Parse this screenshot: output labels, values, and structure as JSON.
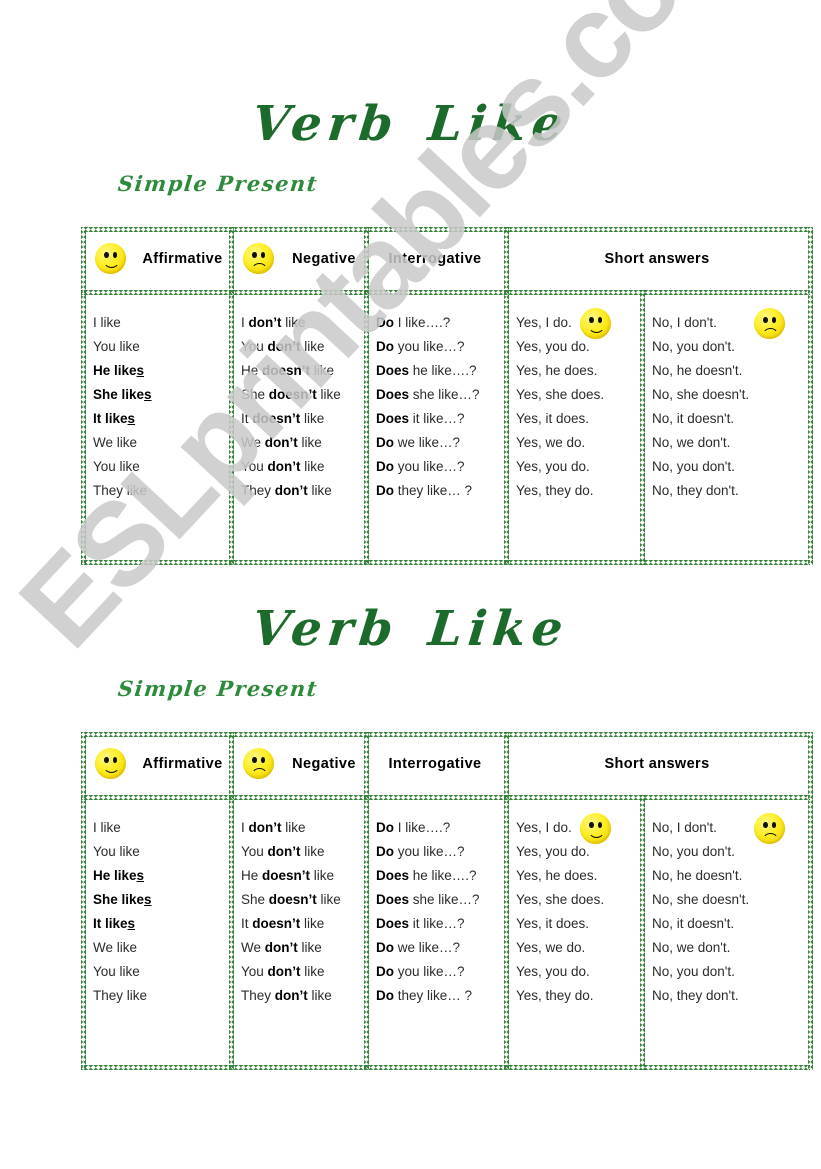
{
  "page": {
    "title": "Verb Like",
    "title_word_1": "Verb",
    "title_word_2": "Like",
    "subtitle": "Simple Present",
    "watermark": "ESLprintables.com",
    "accent_green": "#2d7a33",
    "title_green": "#1d6b2c",
    "subtitle_green": "#2e8b3d",
    "face_yellow": "#ffee26"
  },
  "table": {
    "headers": [
      {
        "label": "Affirmative",
        "icon": "happy-face-icon"
      },
      {
        "label": "Negative",
        "icon": "sad-face-icon"
      },
      {
        "label": "Interrogative",
        "icon": ""
      },
      {
        "label": "Short answers",
        "icon": ""
      }
    ],
    "columns": {
      "affirmative": [
        {
          "subject": "I",
          "verb": "like",
          "bold": false,
          "underline_last": false
        },
        {
          "subject": "You",
          "verb": "like",
          "bold": false,
          "underline_last": false
        },
        {
          "subject": "He",
          "verb": "likes",
          "bold": true,
          "underline_last": true
        },
        {
          "subject": "She",
          "verb": "likes",
          "bold": true,
          "underline_last": true
        },
        {
          "subject": "It",
          "verb": "likes",
          "bold": true,
          "underline_last": true
        },
        {
          "subject": "We",
          "verb": "like",
          "bold": false,
          "underline_last": false
        },
        {
          "subject": "You",
          "verb": "like",
          "bold": false,
          "underline_last": false
        },
        {
          "subject": "They",
          "verb": "like",
          "bold": false,
          "underline_last": false
        }
      ],
      "negative": [
        {
          "subject": "I",
          "aux": "don’t",
          "verb": "like"
        },
        {
          "subject": "You",
          "aux": "don’t",
          "verb": "like"
        },
        {
          "subject": "He",
          "aux": "doesn’t",
          "verb": "like"
        },
        {
          "subject": "She",
          "aux": "doesn’t",
          "verb": "like"
        },
        {
          "subject": "It",
          "aux": "doesn’t",
          "verb": "like"
        },
        {
          "subject": "We",
          "aux": "don’t",
          "verb": "like"
        },
        {
          "subject": "You",
          "aux": "don’t",
          "verb": "like"
        },
        {
          "subject": "They",
          "aux": "don’t",
          "verb": "like"
        }
      ],
      "interrogative": [
        {
          "aux": "Do",
          "rest": "I like….?"
        },
        {
          "aux": "Do",
          "rest": "you like…?"
        },
        {
          "aux": "Does",
          "rest": "he like….?"
        },
        {
          "aux": "Does",
          "rest": "she like…?"
        },
        {
          "aux": "Does",
          "rest": "it like…?"
        },
        {
          "aux": "Do",
          "rest": "we like…?"
        },
        {
          "aux": "Do",
          "rest": "you like…?"
        },
        {
          "aux": "Do",
          "rest": "they like… ?"
        }
      ],
      "short_answers_yes": [
        "Yes, I do.",
        "Yes, you do.",
        "Yes, he does.",
        "Yes, she does.",
        "Yes, it does.",
        "Yes, we do.",
        "Yes, you do.",
        "Yes, they do."
      ],
      "short_answers_no": [
        "No, I don't.",
        "No, you don't.",
        "No, he doesn't.",
        "No, she doesn't.",
        "No, it doesn't.",
        "No, we don't.",
        "No, you don't.",
        "No, they don't."
      ]
    },
    "body_icons": {
      "yes_icon": "happy-face-icon",
      "no_icon": "sad-face-icon"
    }
  }
}
